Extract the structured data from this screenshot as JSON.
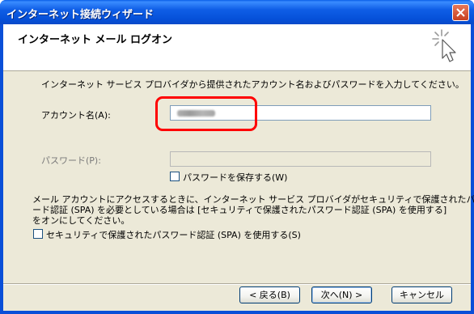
{
  "window": {
    "title": "インターネット接続ウィザード"
  },
  "header": {
    "title": "インターネット メール ログオン"
  },
  "content": {
    "instruction": "インターネット サービス プロバイダから提供されたアカウント名およびパスワードを入力してください。",
    "account_label": "アカウント名(A):",
    "account_value": "",
    "password_label": "パスワード(P):",
    "password_value": "",
    "save_password_label": "パスワードを保存する(W)",
    "spa_note_line1": "メール アカウントにアクセスするときに、インターネット サービス プロバイダがセキュリティで保護されたパスワ",
    "spa_note_line2": "ード認証 (SPA) を必要としている場合は [セキュリティで保護されたパスワード認証 (SPA) を使用する]",
    "spa_note_line3": "をオンにしてください。",
    "spa_checkbox_label": "セキュリティで保護されたパスワード認証 (SPA) を使用する(S)"
  },
  "buttons": {
    "back": "< 戻る(B)",
    "next": "次へ(N) >",
    "cancel": "キャンセル"
  },
  "colors": {
    "titlebar": "#0a5fe8",
    "highlight": "#ff0000",
    "dialog_bg": "#ece9d8"
  }
}
